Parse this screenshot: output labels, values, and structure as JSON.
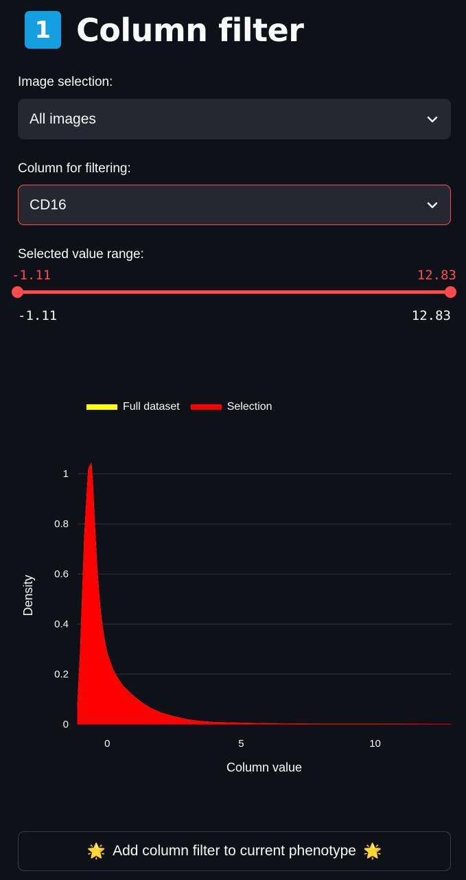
{
  "header": {
    "badge": "1",
    "title": "Column filter"
  },
  "image_selection": {
    "label": "Image selection:",
    "value": "All images"
  },
  "column_filter": {
    "label": "Column for filtering:",
    "value": "CD16"
  },
  "range": {
    "label": "Selected value range:",
    "selected_min": "-1.11",
    "selected_max": "12.83",
    "bound_min": "-1.11",
    "bound_max": "12.83"
  },
  "colors": {
    "accent": "#ff4b4b",
    "full_dataset": "#ffff00",
    "selection": "#ff0000"
  },
  "chart_data": {
    "type": "area",
    "xlabel": "Column value",
    "ylabel": "Density",
    "xlim": [
      -1.11,
      12.83
    ],
    "ylim": [
      0,
      1.05
    ],
    "xticks": [
      0,
      5,
      10
    ],
    "yticks": [
      0,
      0.2,
      0.4,
      0.6,
      0.8,
      1
    ],
    "grid": true,
    "legend_position": "top-left",
    "series": [
      {
        "name": "Full dataset",
        "color": "#ffff00",
        "x": [
          -1.11,
          -1.0,
          -0.85,
          -0.7,
          -0.6,
          -0.55,
          -0.5,
          -0.4,
          -0.3,
          -0.2,
          -0.1,
          0,
          0.2,
          0.4,
          0.6,
          0.8,
          1.0,
          1.3,
          1.6,
          2.0,
          2.5,
          3.0,
          3.5,
          4.0,
          5.0,
          6.0,
          7.0,
          8.0,
          10.0,
          12.83
        ],
        "values": [
          0.07,
          0.3,
          0.75,
          1.02,
          1.04,
          0.97,
          0.85,
          0.65,
          0.5,
          0.4,
          0.33,
          0.28,
          0.22,
          0.18,
          0.15,
          0.13,
          0.11,
          0.085,
          0.065,
          0.045,
          0.03,
          0.018,
          0.011,
          0.007,
          0.004,
          0.002,
          0.001,
          0.0005,
          0.0002,
          0.0001
        ]
      },
      {
        "name": "Selection",
        "color": "#ff0000",
        "x": [
          -1.11,
          -1.0,
          -0.85,
          -0.7,
          -0.6,
          -0.55,
          -0.5,
          -0.4,
          -0.3,
          -0.2,
          -0.1,
          0,
          0.2,
          0.4,
          0.6,
          0.8,
          1.0,
          1.3,
          1.6,
          2.0,
          2.5,
          3.0,
          3.5,
          4.0,
          5.0,
          6.0,
          7.0,
          8.0,
          10.0,
          12.83
        ],
        "values": [
          0.07,
          0.3,
          0.75,
          1.02,
          1.04,
          0.97,
          0.85,
          0.65,
          0.5,
          0.4,
          0.33,
          0.28,
          0.22,
          0.18,
          0.15,
          0.13,
          0.11,
          0.085,
          0.065,
          0.045,
          0.03,
          0.018,
          0.011,
          0.007,
          0.004,
          0.002,
          0.001,
          0.0005,
          0.0002,
          0.0001
        ]
      }
    ]
  },
  "action": {
    "icon_left": "🌟",
    "label": "Add column filter to current phenotype",
    "icon_right": "🌟"
  }
}
